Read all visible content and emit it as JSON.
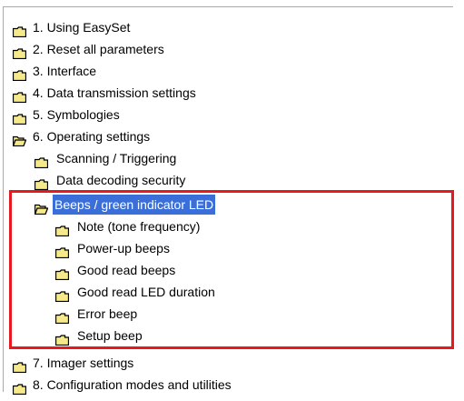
{
  "tree": {
    "items": [
      {
        "label": "1. Using EasySet",
        "icon": "folder-closed-icon"
      },
      {
        "label": "2. Reset all parameters",
        "icon": "folder-closed-icon"
      },
      {
        "label": "3. Interface",
        "icon": "folder-closed-icon"
      },
      {
        "label": "4. Data transmission settings",
        "icon": "folder-closed-icon"
      },
      {
        "label": "5. Symbologies",
        "icon": "folder-closed-icon"
      },
      {
        "label": "6. Operating settings",
        "icon": "folder-open-icon"
      },
      {
        "label": "Scanning / Triggering",
        "icon": "folder-closed-icon"
      },
      {
        "label": "Data decoding security",
        "icon": "folder-closed-icon"
      },
      {
        "label": "Beeps / green indicator LED",
        "icon": "folder-open-icon"
      },
      {
        "label": "Note (tone frequency)",
        "icon": "folder-closed-icon"
      },
      {
        "label": "Power-up beeps",
        "icon": "folder-closed-icon"
      },
      {
        "label": "Good read beeps",
        "icon": "folder-closed-icon"
      },
      {
        "label": "Good read LED duration",
        "icon": "folder-closed-icon"
      },
      {
        "label": "Error beep",
        "icon": "folder-closed-icon"
      },
      {
        "label": "Setup beep",
        "icon": "folder-closed-icon"
      },
      {
        "label": "7. Imager settings",
        "icon": "folder-closed-icon"
      },
      {
        "label": "8. Configuration modes and utilities",
        "icon": "folder-closed-icon"
      }
    ],
    "selected_label": "Beeps / green indicator LED"
  },
  "colors": {
    "selection": "#3a6fd9",
    "highlight_border": "#e8191e",
    "folder_fill": "#f5e98a",
    "folder_outline": "#000000"
  }
}
